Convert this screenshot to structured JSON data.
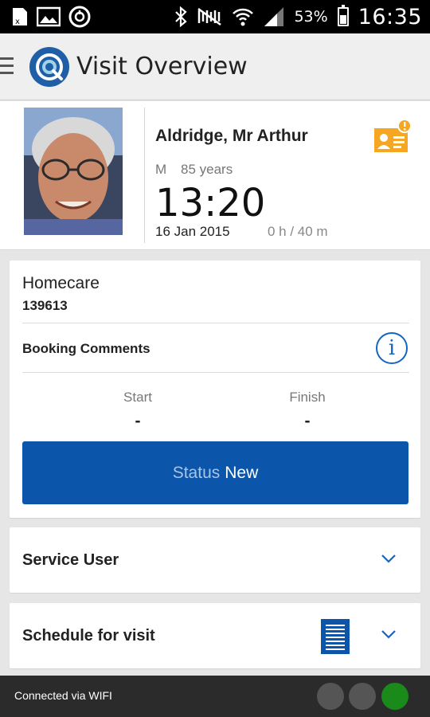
{
  "status_bar": {
    "battery_percent": "53%",
    "battery_level": 0.53,
    "time": "16:35",
    "icons": [
      "sd-card-icon",
      "gallery-icon",
      "sync-icon",
      "bluetooth-icon",
      "mute-icon",
      "wifi-icon",
      "signal-icon",
      "battery-icon"
    ]
  },
  "app_bar": {
    "title": "Visit Overview"
  },
  "patient": {
    "name": "Aldridge, Mr Arthur",
    "gender": "M",
    "age": "85 years",
    "time": "13:20",
    "date": "16 Jan 2015",
    "duration": "0 h / 40 m"
  },
  "booking": {
    "service_type": "Homecare",
    "reference": "139613",
    "comments_label": "Booking Comments",
    "start_label": "Start",
    "start_value": "-",
    "finish_label": "Finish",
    "finish_value": "-",
    "status_label": "Status",
    "status_value": "New"
  },
  "sections": {
    "service_user": "Service User",
    "schedule": "Schedule for visit"
  },
  "footer": {
    "connection": "Connected via WIFI",
    "indicator_colors": [
      "#555555",
      "#555555",
      "#1a8a1a"
    ]
  },
  "colors": {
    "primary": "#0b56aa",
    "alert": "#f5a623"
  }
}
